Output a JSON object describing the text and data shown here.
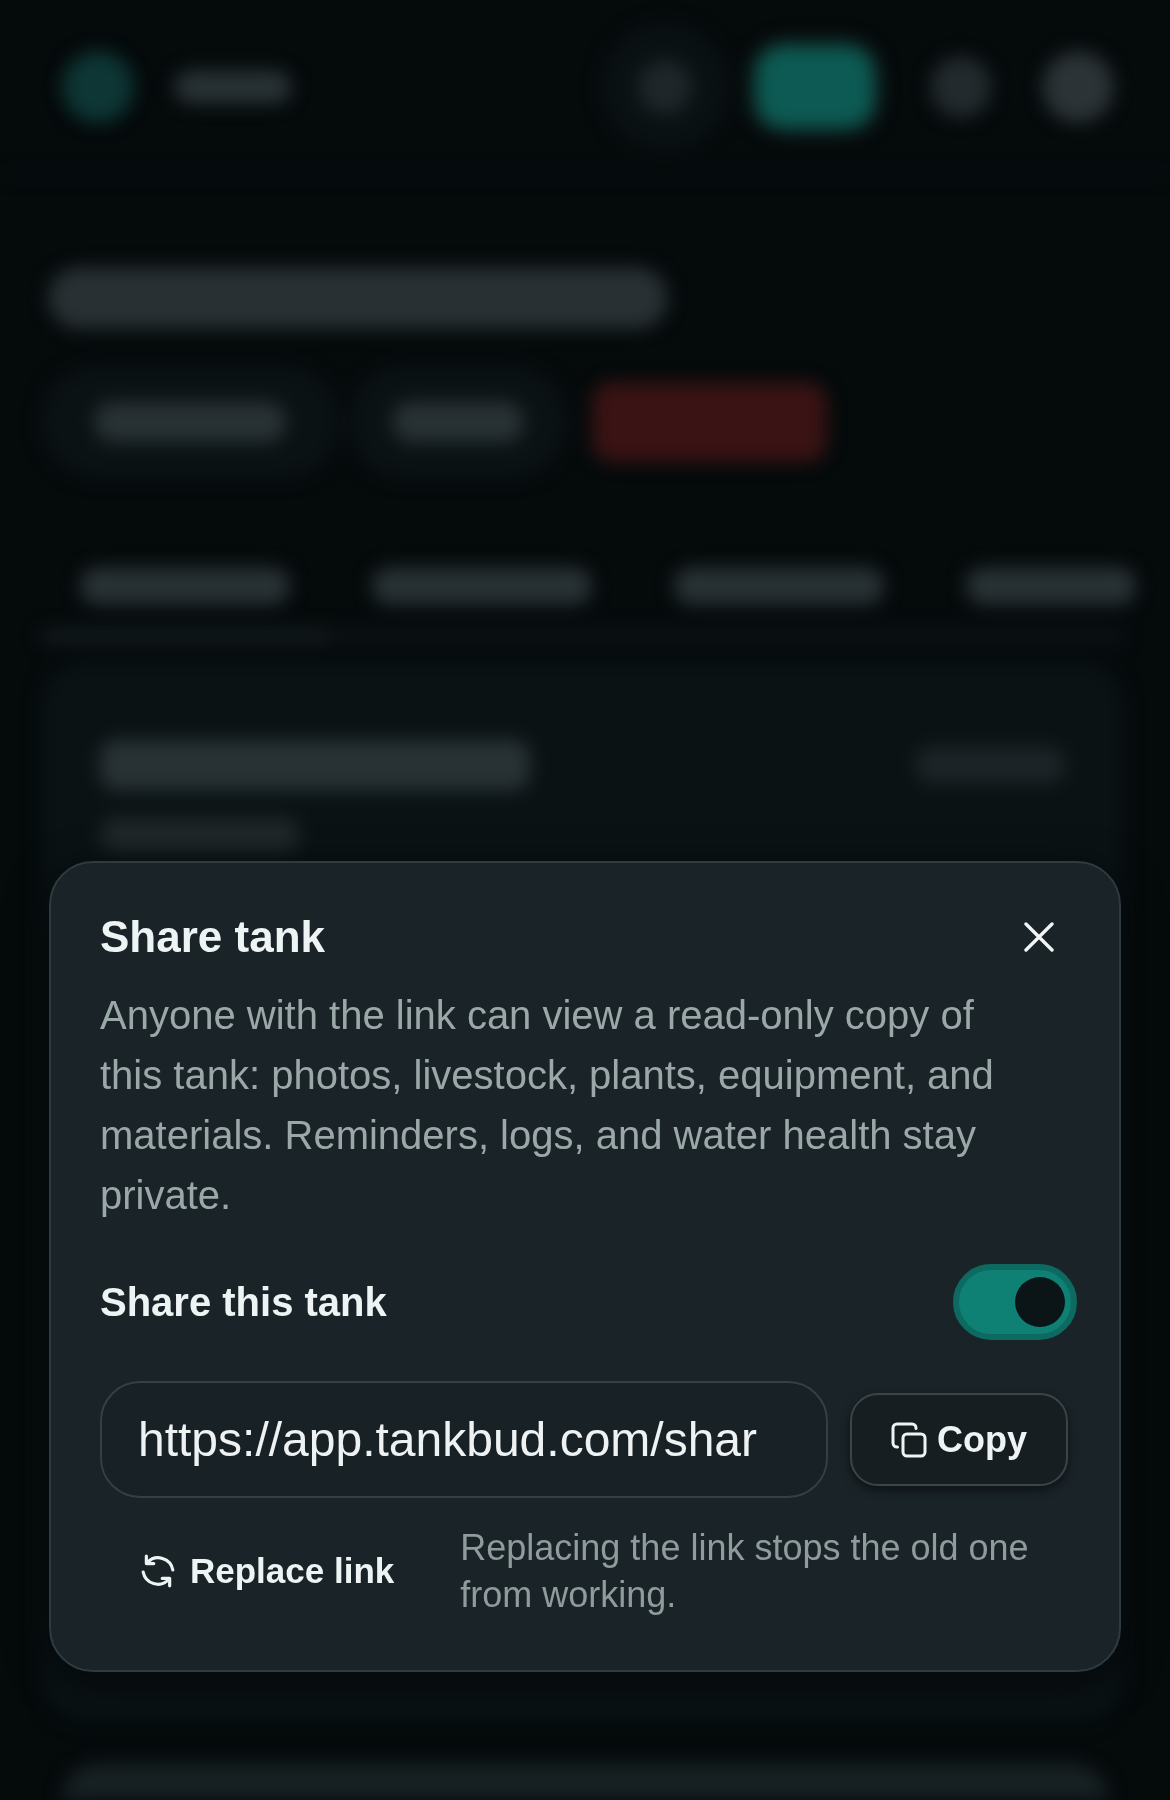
{
  "dialog": {
    "title": "Share tank",
    "description": "Anyone with the link can view a read-only copy of this tank: photos, livestock, plants, equipment, and materials. Reminders, logs, and water health stay private.",
    "share_toggle": {
      "label": "Share this tank",
      "on": true
    },
    "link": {
      "value": "https://app.tankbud.com/shar"
    },
    "copy_button": {
      "label": "Copy"
    },
    "replace_button": {
      "label": "Replace link"
    },
    "replace_hint": "Replacing the link stops the old one from working."
  }
}
